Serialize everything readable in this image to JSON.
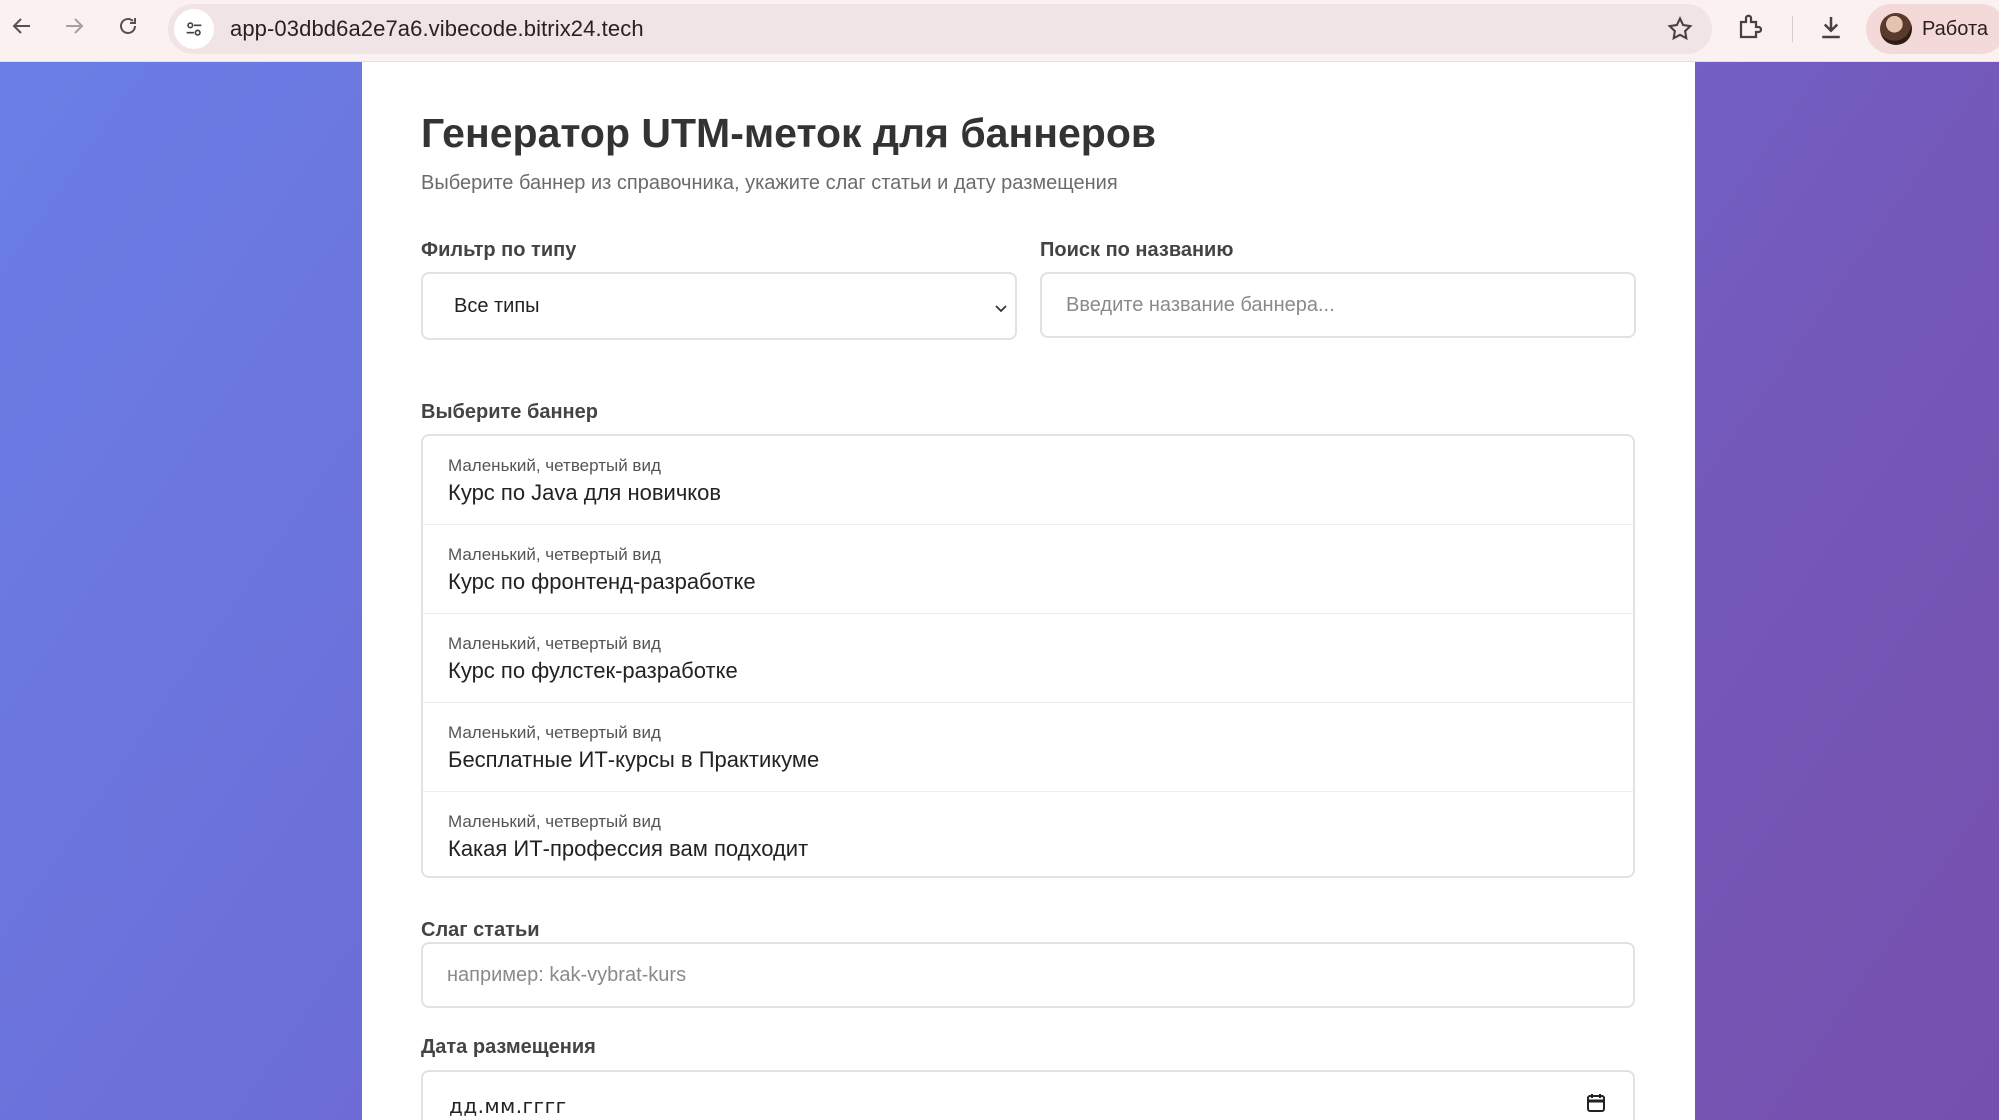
{
  "browser": {
    "url": "app-03dbd6a2e7a6.vibecode.bitrix24.tech",
    "profile_name": "Работа"
  },
  "page": {
    "title": "Генератор UTM-меток для баннеров",
    "subtitle": "Выберите баннер из справочника, укажите слаг статьи и дату размещения",
    "filter_label": "Фильтр по типу",
    "filter_value": "Все типы",
    "search_label": "Поиск по названию",
    "search_placeholder": "Введите название баннера...",
    "banner_label": "Выберите баннер",
    "banners": [
      {
        "type": "Маленький, четвертый вид",
        "name": "Курс по Java для новичков"
      },
      {
        "type": "Маленький, четвертый вид",
        "name": "Курс по фронтенд-разработке"
      },
      {
        "type": "Маленький, четвертый вид",
        "name": "Курс по фулстек-разработке"
      },
      {
        "type": "Маленький, четвертый вид",
        "name": "Бесплатные ИТ-курсы в Практикуме"
      },
      {
        "type": "Маленький, четвертый вид",
        "name": "Какая ИТ-профессия вам подходит"
      }
    ],
    "slug_label": "Слаг статьи",
    "slug_placeholder": "например: kak-vybrat-kurs",
    "date_label": "Дата размещения",
    "date_placeholder": "дд.мм.гггг"
  },
  "colors": {
    "gradient_start": "#6a7fe6",
    "gradient_end": "#7650ad"
  }
}
